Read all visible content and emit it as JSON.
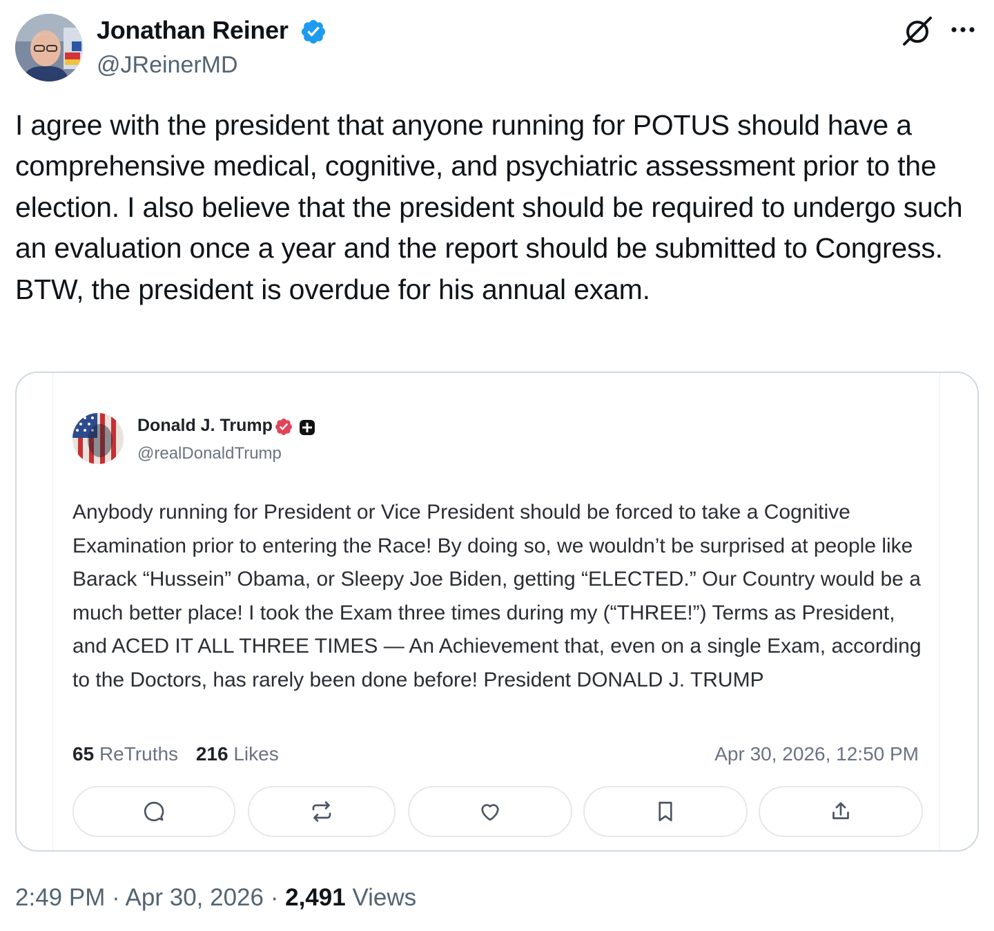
{
  "author": {
    "name": "Jonathan Reiner",
    "handle": "@JReinerMD",
    "verified_color": "#1d9bf0"
  },
  "tweet": {
    "text": "I agree with the president that anyone running for POTUS should have a comprehensive medical, cognitive, and psychiatric assessment prior to the election. I also believe that the president should be required to undergo such an evaluation once a year and the report should be submitted to Congress. BTW, the president is overdue for his annual exam."
  },
  "header_icons": [
    "grok-icon",
    "more-icon"
  ],
  "embed": {
    "author": {
      "name": "Donald J. Trump",
      "handle": "@realDonaldTrump",
      "badge_color": "#e0445a"
    },
    "text": "Anybody running for President or Vice President should be forced to take a Cognitive Examination prior to entering the Race! By doing so, we wouldn’t be surprised at people like Barack “Hussein” Obama, or Sleepy Joe Biden, getting “ELECTED.” Our Country would be a much better place! I took the Exam three times during my (“THREE!”) Terms as President, and ACED IT ALL THREE TIMES — An Achievement that, even on a single Exam, according to the Doctors, has rarely been done before! President DONALD J. TRUMP",
    "retruths_count": "65",
    "retruths_label": "ReTruths",
    "likes_count": "216",
    "likes_label": "Likes",
    "date": "Apr 30, 2026, 12:50 PM",
    "actions": [
      "reply-icon",
      "retruth-icon",
      "like-icon",
      "bookmark-icon",
      "share-icon"
    ]
  },
  "meta": {
    "time": "2:49 PM",
    "sep": "·",
    "date": "Apr 30, 2026",
    "views_count": "2,491",
    "views_label": "Views"
  }
}
